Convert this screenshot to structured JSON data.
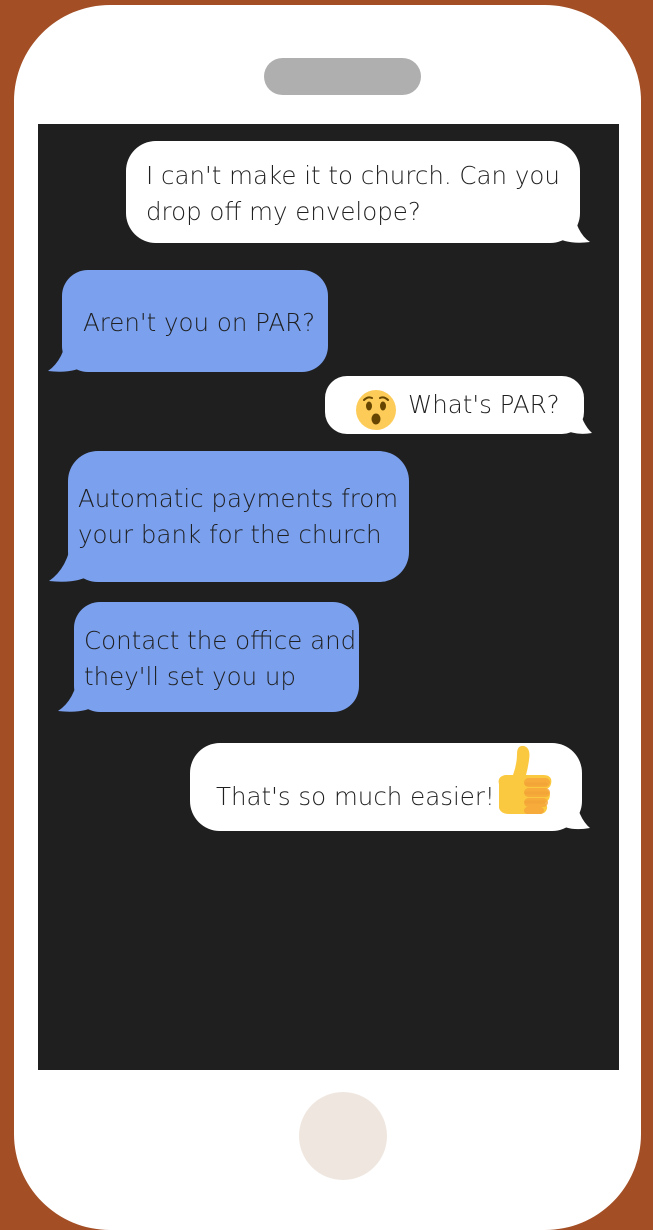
{
  "conversation": {
    "messages": [
      {
        "id": "m1",
        "from": "me",
        "text": "I can't make it to church. Can you\ndrop off my envelope?"
      },
      {
        "id": "m2",
        "from": "them",
        "text": "Aren't you on PAR?"
      },
      {
        "id": "m3",
        "from": "me",
        "text": "What's PAR?",
        "emoji": "hushed-face-emoji"
      },
      {
        "id": "m4",
        "from": "them",
        "text": "Automatic payments from\nyour bank for the church"
      },
      {
        "id": "m5",
        "from": "them",
        "text": "Contact the office and\nthey'll set you up"
      },
      {
        "id": "m6",
        "from": "me",
        "text": "That's so much easier!",
        "emoji": "thumbs-up-emoji"
      }
    ]
  },
  "colors": {
    "frame": "#a34e24",
    "phone_body": "#ffffff",
    "screen": "#1f1f1f",
    "incoming_bubble": "#7aa0ee",
    "outgoing_bubble": "#ffffff",
    "speaker": "#b0afaf",
    "home_button": "#efe6df"
  }
}
